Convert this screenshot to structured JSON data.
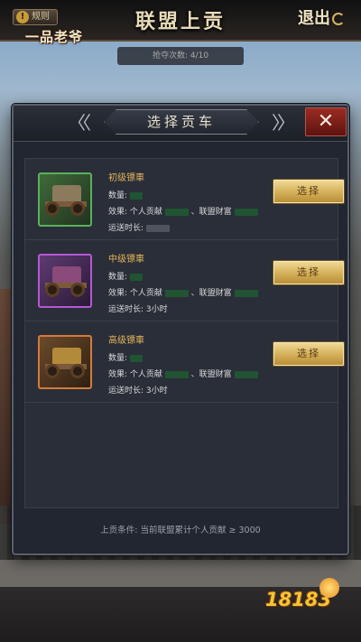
{
  "topbar": {
    "rules_label": "规则",
    "game_logo": "一品老爷",
    "title": "联盟上贡",
    "exit_label": "退出",
    "count_text": "抢夺次数: 4/10"
  },
  "modal": {
    "title": "选择贡车",
    "close_glyph": "✕",
    "deco_left": "〈〈",
    "deco_right": "〉〉",
    "condition_text": "上贡条件: 当前联盟累计个人贡献 ≥ 3000",
    "carts": [
      {
        "name": "初级镖車",
        "quantity_label": "数量:",
        "effect_label": "效果: 个人贡献",
        "effect_alliance_label": "、联盟财富",
        "duration_label": "运送时长:",
        "duration_value": "",
        "select_label": "选择",
        "frame": "green",
        "cart_color": "#8b7a5c"
      },
      {
        "name": "中级镖車",
        "quantity_label": "数量:",
        "effect_label": "效果: 个人贡献",
        "effect_alliance_label": "、联盟财富",
        "duration_label": "运送时长:",
        "duration_value": "3小时",
        "select_label": "选择",
        "frame": "purple",
        "cart_color": "#8a4a7a"
      },
      {
        "name": "高级镖車",
        "quantity_label": "数量:",
        "effect_label": "效果: 个人贡献",
        "effect_alliance_label": "、联盟财富",
        "duration_label": "运送时长:",
        "duration_value": "3小时",
        "select_label": "选择",
        "frame": "orange",
        "cart_color": "#b38a3a"
      }
    ]
  },
  "watermark": "18183",
  "colors": {
    "accent_gold": "#e3b45c",
    "close_red": "#9b2b22",
    "hidden_value_green": "#1f5a33"
  }
}
